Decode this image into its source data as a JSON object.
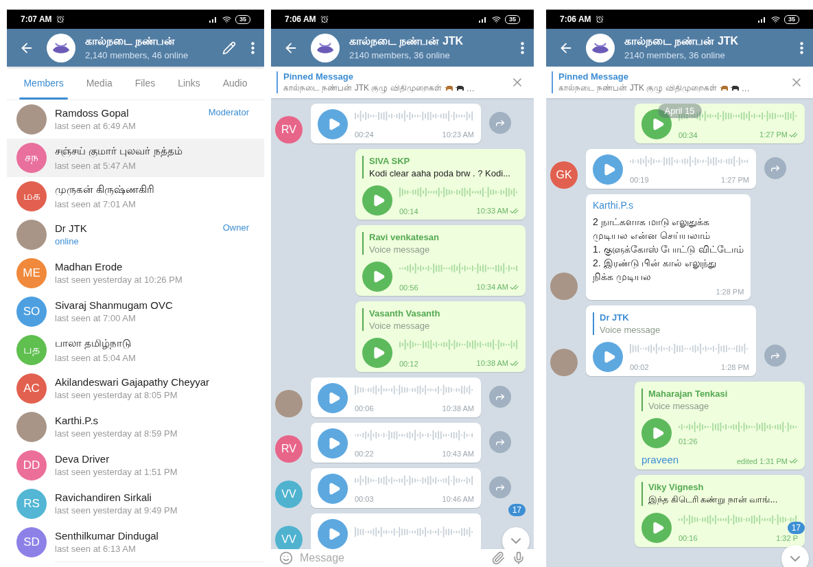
{
  "screens": [
    {
      "kind": "members",
      "status": {
        "time": "7:07 AM",
        "battery": "35"
      },
      "header": {
        "title": "கால்நடை நண்பன்",
        "subtitle": "2,140 members, 46 online",
        "edit": true
      },
      "tabs": [
        {
          "label": "Members",
          "selected": true
        },
        {
          "label": "Media",
          "selected": false
        },
        {
          "label": "Files",
          "selected": false
        },
        {
          "label": "Links",
          "selected": false
        },
        {
          "label": "Audio",
          "selected": false
        }
      ],
      "members": [
        {
          "name": "Ramdoss Gopal",
          "status": "last seen at 6:49 AM",
          "online": false,
          "role": "Moderator",
          "selected": false,
          "avatar": {
            "kind": "photo"
          }
        },
        {
          "name": "சஞ்சய் குமார் புலவர் நத்தம்",
          "status": "last seen at 5:47 AM",
          "online": false,
          "selected": true,
          "avatar": {
            "kind": "initials",
            "text": "சந",
            "color": "#e96f9c"
          }
        },
        {
          "name": "முருகன் கிருஷ்ணகிரி",
          "status": "last seen at 7:01 AM",
          "online": false,
          "selected": false,
          "avatar": {
            "kind": "initials",
            "text": "மக",
            "color": "#e2604f"
          }
        },
        {
          "name": "Dr JTK",
          "status": "online",
          "online": true,
          "role": "Owner",
          "selected": false,
          "avatar": {
            "kind": "photo"
          }
        },
        {
          "name": "Madhan Erode",
          "status": "last seen yesterday at 10:26 PM",
          "online": false,
          "selected": false,
          "avatar": {
            "kind": "initials",
            "text": "ME",
            "color": "#f0893b"
          }
        },
        {
          "name": "Sivaraj Shanmugam OVC",
          "status": "last seen at 7:00 AM",
          "online": false,
          "selected": false,
          "avatar": {
            "kind": "initials",
            "text": "SO",
            "color": "#4d9fe0"
          }
        },
        {
          "name": "பாலா தமிழ்நாடு",
          "status": "last seen at 5:04 AM",
          "online": false,
          "selected": false,
          "avatar": {
            "kind": "initials",
            "text": "பத",
            "color": "#5fbf4f"
          }
        },
        {
          "name": "Akilandeswari Gajapathy Cheyyar",
          "status": "last seen yesterday at 8:05 PM",
          "online": false,
          "selected": false,
          "avatar": {
            "kind": "initials",
            "text": "AC",
            "color": "#e2604f"
          }
        },
        {
          "name": "Karthi.P.s",
          "status": "last seen yesterday at 8:59 PM",
          "online": false,
          "selected": false,
          "avatar": {
            "kind": "photo"
          }
        },
        {
          "name": "Deva Driver",
          "status": "last seen yesterday at 1:51 PM",
          "online": false,
          "selected": false,
          "avatar": {
            "kind": "initials",
            "text": "DD",
            "color": "#ec6f99"
          }
        },
        {
          "name": "Ravichandiren Sirkali",
          "status": "last seen yesterday at 9:49 PM",
          "online": false,
          "selected": false,
          "avatar": {
            "kind": "initials",
            "text": "RS",
            "color": "#52b6d4"
          }
        },
        {
          "name": "Senthilkumar Dindugal",
          "status": "last seen at 6:13 AM",
          "online": false,
          "selected": false,
          "avatar": {
            "kind": "initials",
            "text": "SD",
            "color": "#8d81e8"
          }
        }
      ]
    },
    {
      "kind": "chat",
      "status": {
        "time": "7:06 AM",
        "battery": "35"
      },
      "header": {
        "title": "கால்நடை நண்பன் JTK",
        "subtitle": "2140 members, 36 online",
        "edit": false
      },
      "pinned": {
        "title": "Pinned Message",
        "text": "கால்நடை நண்பன் JTK குழு விதிமுறைகள்",
        "tail": "…"
      },
      "messages": [
        {
          "kind": "voice",
          "outgoing": false,
          "avatar": {
            "kind": "initials",
            "text": "RV",
            "color": "#e8658a"
          },
          "share": true,
          "duration": "00:24",
          "time": "10:23 AM"
        },
        {
          "kind": "voice",
          "outgoing": true,
          "read": true,
          "quote": {
            "kind": "text",
            "name": "SIVA SKP",
            "text": "Kodi clear aaha poda brw . ?  Kodi..."
          },
          "duration": "00:14",
          "time": "10:33 AM"
        },
        {
          "kind": "voice",
          "outgoing": true,
          "read": true,
          "quote": {
            "kind": "voice",
            "name": "Ravi venkatesan",
            "text": "Voice message"
          },
          "duration": "00:56",
          "time": "10:34 AM"
        },
        {
          "kind": "voice",
          "outgoing": true,
          "read": true,
          "quote": {
            "kind": "voice",
            "name": "Vasanth Vasanth",
            "text": "Voice message"
          },
          "duration": "00:12",
          "time": "10:38 AM"
        },
        {
          "kind": "voice",
          "outgoing": false,
          "avatar": {
            "kind": "photo"
          },
          "share": true,
          "duration": "00:06",
          "time": "10:38 AM"
        },
        {
          "kind": "voice",
          "outgoing": false,
          "avatar": {
            "kind": "initials",
            "text": "RV",
            "color": "#e8658a"
          },
          "share": true,
          "duration": "00:22",
          "time": "10:43 AM"
        },
        {
          "kind": "voice",
          "outgoing": false,
          "avatar": {
            "kind": "initials",
            "text": "VV",
            "color": "#4fb3d0"
          },
          "share": true,
          "duration": "00:03",
          "time": "10:46 AM"
        },
        {
          "kind": "voice",
          "outgoing": false,
          "avatar": {
            "kind": "initials",
            "text": "VV",
            "color": "#4fb3d0"
          }
        }
      ],
      "scroll_button": {
        "unread": "17"
      },
      "composer": {
        "placeholder": "Message"
      }
    },
    {
      "kind": "chat",
      "status": {
        "time": "7:06 AM",
        "battery": "35"
      },
      "header": {
        "title": "கால்நடை நண்பன் JTK",
        "subtitle": "2140 members, 36 online",
        "edit": false
      },
      "pinned": {
        "title": "Pinned Message",
        "text": "கால்நடை நண்பன் JTK குழு விதிமுறைகள்",
        "tail": "…"
      },
      "date_chip": "April 15",
      "messages": [
        {
          "kind": "voice",
          "outgoing": true,
          "read": true,
          "duration": "00:34",
          "time": "1:27 PM"
        },
        {
          "kind": "voice",
          "outgoing": false,
          "avatar": {
            "kind": "initials",
            "text": "GK",
            "color": "#e2604f"
          },
          "share": true,
          "duration": "00:19",
          "time": "1:27 PM"
        },
        {
          "kind": "text",
          "outgoing": false,
          "avatar": {
            "kind": "photo"
          },
          "sender": "Karthi.P.s",
          "text": "2 நாட்களாக மாடு எலுதுக்க\nமுடியல என்ன செய்யலாம்\n1. குளுக்கோஸ் போட்டு விட்டோம்\n2. இரண்டு பின் கால் எலுந்து\nநிக்க முடியல",
          "time": "1:28 PM"
        },
        {
          "kind": "voice",
          "outgoing": false,
          "avatar": {
            "kind": "photo"
          },
          "share": true,
          "quote": {
            "kind": "voice",
            "name": "Dr JTK",
            "text": "Voice message"
          },
          "duration": "00:02",
          "time": "1:28 PM"
        },
        {
          "kind": "voice",
          "outgoing": true,
          "read": true,
          "quote": {
            "kind": "voice",
            "name": "Maharajan Tenkasi",
            "text": "Voice message"
          },
          "duration": "01:26",
          "signature": "praveen",
          "time": "edited 1:31 PM"
        },
        {
          "kind": "voice",
          "outgoing": true,
          "read": false,
          "quote": {
            "kind": "text",
            "name": "Viky Vignesh",
            "text": "இந்த கிடெரி கண்று நான் வாங்..."
          },
          "duration": "00:16",
          "time": "1:32 P"
        }
      ],
      "scroll_button": {
        "unread": "17"
      }
    }
  ]
}
